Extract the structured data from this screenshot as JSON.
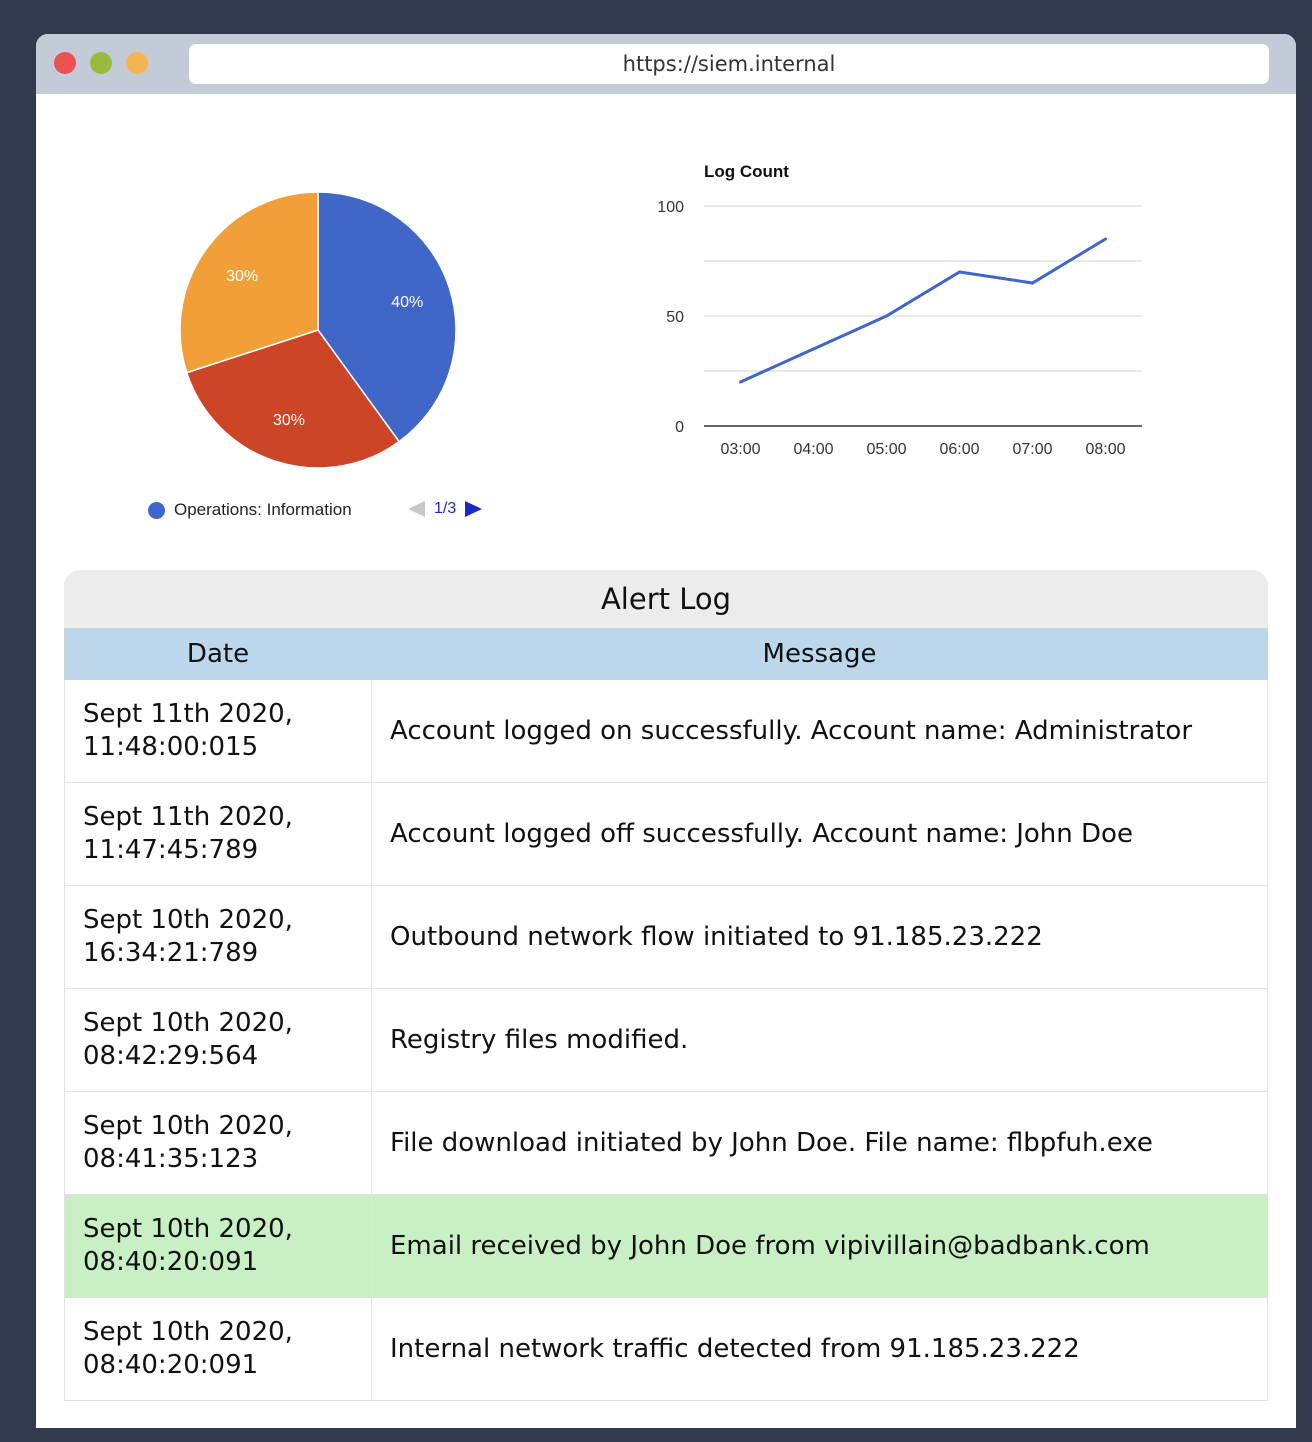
{
  "browser": {
    "url": "https://siem.internal"
  },
  "pie_chart": {
    "legend_label": "Operations: Information",
    "legend_color": "#3f66c9",
    "pager_text": "1/3",
    "slice_labels": [
      "40%",
      "30%",
      "30%"
    ]
  },
  "chart_data": [
    {
      "type": "pie",
      "values": [
        40,
        30,
        30
      ],
      "labels": [
        "40%",
        "30%",
        "30%"
      ],
      "colors": [
        "#4066c8",
        "#cc4526",
        "#f1a039"
      ],
      "legend": [
        "Operations: Information"
      ],
      "legend_position": "bottom"
    },
    {
      "type": "line",
      "title": "Log Count",
      "categories": [
        "03:00",
        "04:00",
        "05:00",
        "06:00",
        "07:00",
        "08:00"
      ],
      "values": [
        20,
        35,
        50,
        70,
        65,
        85
      ],
      "ylim": [
        0,
        100
      ],
      "yticks": [
        0,
        50,
        100
      ],
      "grid": true,
      "color": "#4066c8"
    }
  ],
  "alert_log": {
    "title": "Alert Log",
    "columns": [
      "Date",
      "Message"
    ],
    "rows": [
      {
        "date": [
          "Sept 11th 2020,",
          "11:48:00:015"
        ],
        "message": "Account logged on successfully. Account name: Administrator"
      },
      {
        "date": [
          "Sept 11th 2020,",
          "11:47:45:789"
        ],
        "message": "Account logged off successfully. Account name: John Doe"
      },
      {
        "date": [
          "Sept 10th 2020,",
          "16:34:21:789"
        ],
        "message": "Outbound network flow initiated to 91.185.23.222"
      },
      {
        "date": [
          "Sept 10th 2020,",
          "08:42:29:564"
        ],
        "message": "Registry files modified."
      },
      {
        "date": [
          "Sept 10th 2020,",
          "08:41:35:123"
        ],
        "message": "File download initiated by John Doe. File name: flbpfuh.exe"
      },
      {
        "date": [
          "Sept 10th 2020,",
          "08:40:20:091"
        ],
        "message": "Email received by John Doe from vipivillain@badbank.com"
      },
      {
        "date": [
          "Sept 10th 2020,",
          "08:40:20:091"
        ],
        "message": "Internal network traffic detected from 91.185.23.222"
      }
    ],
    "highlight_color": "#c9f0c4"
  }
}
